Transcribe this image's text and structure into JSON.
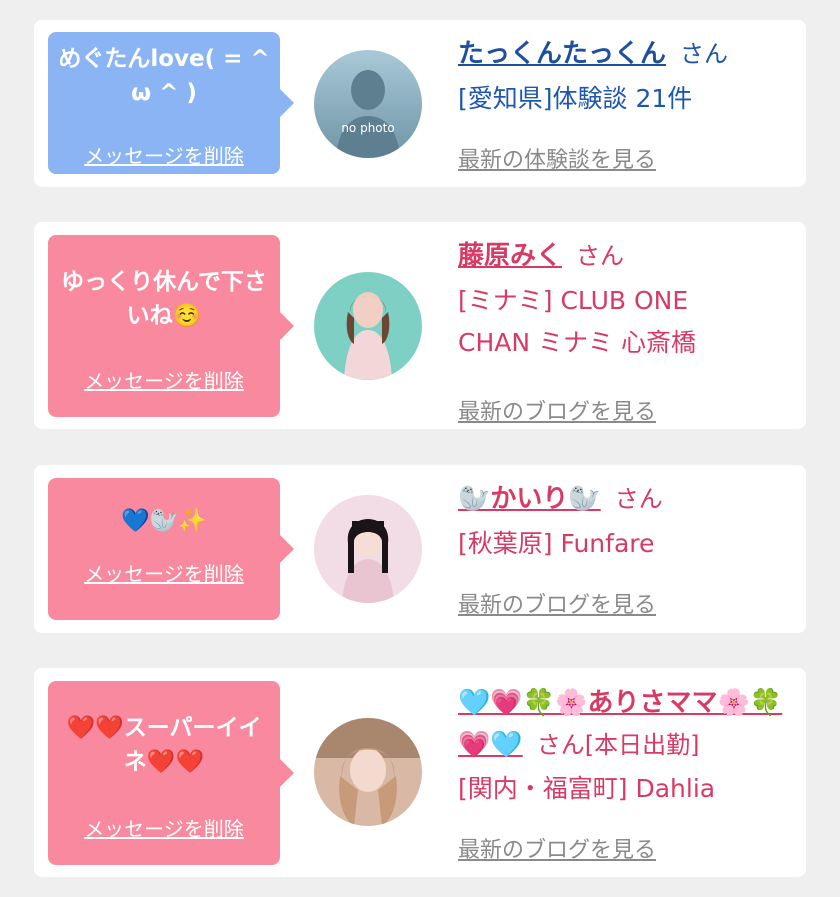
{
  "messages": [
    {
      "bubble_text": "めぐたんlove( = ^ ω ^ )",
      "delete_label": "メッセージを削除",
      "name": "たっくんたっくん",
      "honorific": "さん",
      "store_line1": "[愛知県]体験談 21件",
      "store_line2": "",
      "more_label": "最新の体験談を見る",
      "avatar_label": "no photo"
    },
    {
      "bubble_text": "ゆっくり休んで下さいね☺️",
      "delete_label": "メッセージを削除",
      "name": "藤原みく",
      "honorific": "さん",
      "store_line1": "[ミナミ] CLUB ONE",
      "store_line2": "CHAN ミナミ 心斎橋",
      "more_label": "最新のブログを見る"
    },
    {
      "bubble_text": "💙🦭✨",
      "delete_label": "メッセージを削除",
      "name": "🦭かいり🦭",
      "honorific": "さん",
      "store_line1": "[秋葉原] Funfare",
      "store_line2": "",
      "more_label": "最新のブログを見る"
    },
    {
      "bubble_text": "❤️❤️スーパーイイネ❤️❤️",
      "delete_label": "メッセージを削除",
      "name": "🩵💗🍀🌸ありさママ🌸🍀💗🩵",
      "honorific": "さん[本日出勤]",
      "store_line1": "[関内・福富町] Dahlia",
      "store_line2": "",
      "more_label": "最新のブログを見る"
    }
  ],
  "colors": {
    "background": "#efefef",
    "bubble_blue": "#8ab4f4",
    "bubble_pink": "#f8899e",
    "text_blue": "#1f57b0",
    "text_pink": "#d83a66",
    "link_gray": "#8a8a8a"
  }
}
